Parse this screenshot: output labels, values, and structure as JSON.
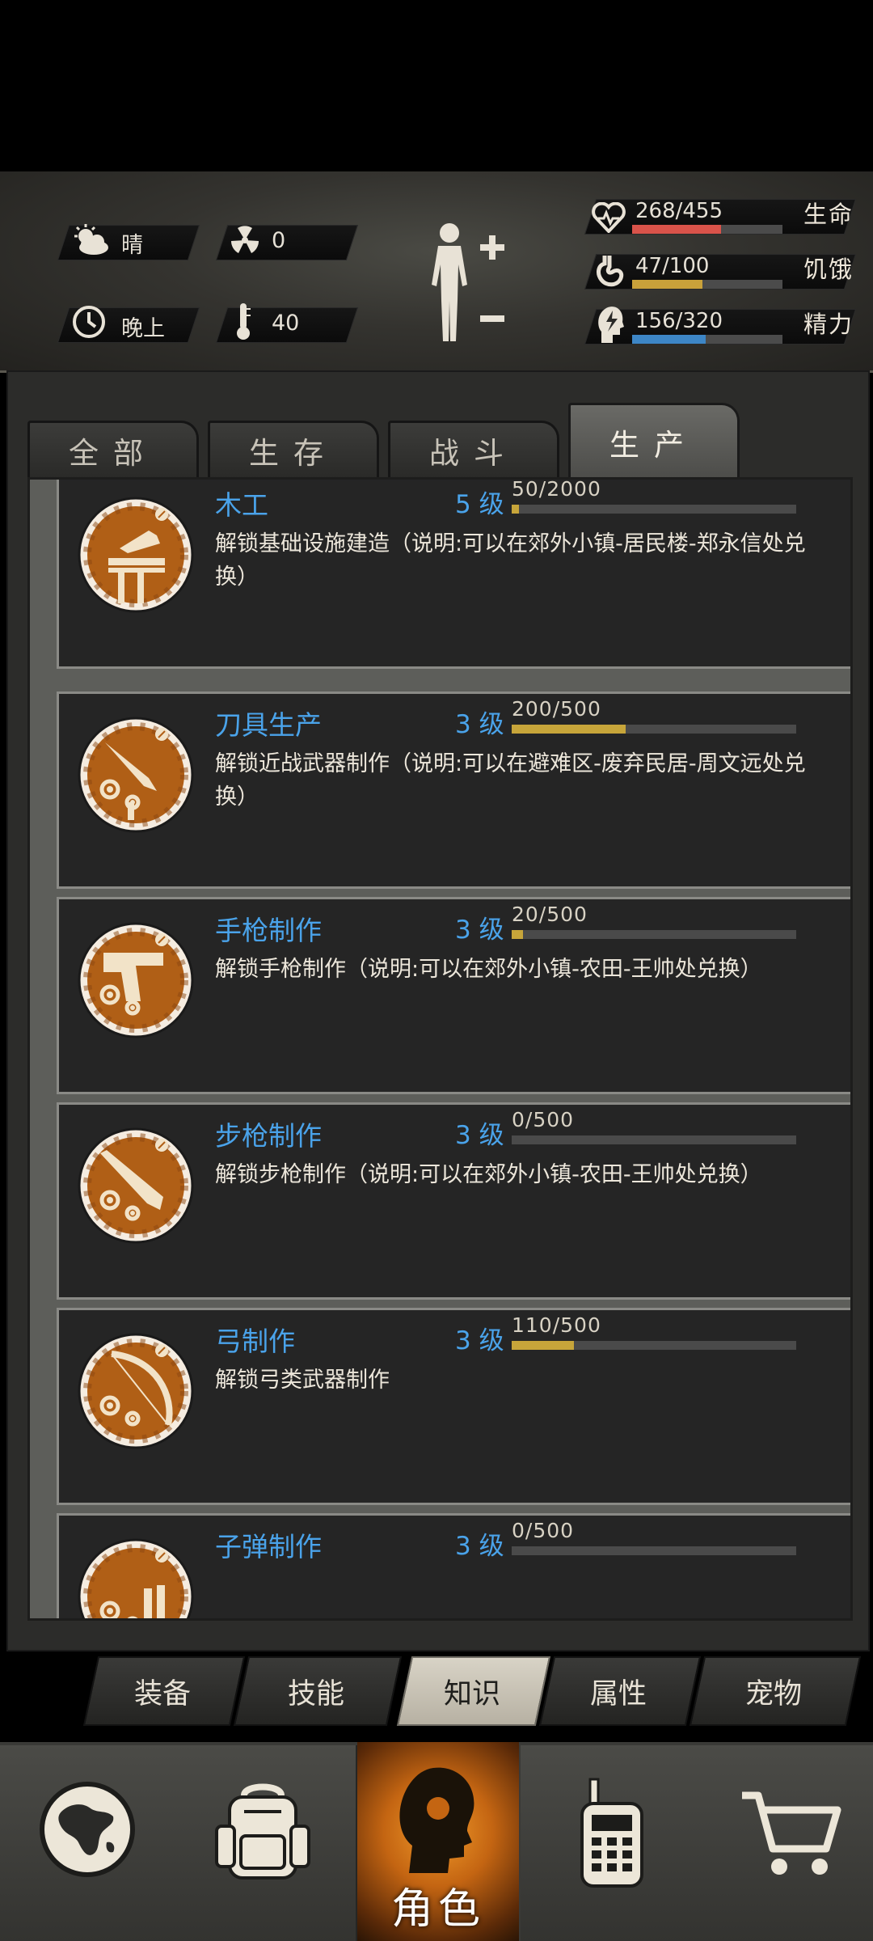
{
  "status": {
    "weather": "晴",
    "radiation": "0",
    "time_of_day": "晚上",
    "temperature": "40",
    "life": {
      "label": "生命",
      "text": "268/455",
      "fraction": 0.589,
      "color": "#d9534a"
    },
    "hunger": {
      "label": "饥饿",
      "text": "47/100",
      "fraction": 0.47,
      "color": "#c9a13a"
    },
    "energy": {
      "label": "精力",
      "text": "156/320",
      "fraction": 0.4875,
      "color": "#3d86c6"
    }
  },
  "tabs": [
    "全部",
    "生存",
    "战斗",
    "生产"
  ],
  "active_tab": 3,
  "skills": [
    {
      "name": "木工",
      "level": "5 级",
      "progress": "50/2000",
      "fraction": 0.025,
      "desc": "解锁基础设施建造（说明:可以在郊外小镇-居民楼-郑永信处兑换）",
      "icon": "woodwork-icon"
    },
    {
      "name": "刀具生产",
      "level": "3 级",
      "progress": "200/500",
      "fraction": 0.4,
      "desc": "解锁近战武器制作（说明:可以在避难区-废弃民居-周文远处兑换）",
      "icon": "knife-gear-icon"
    },
    {
      "name": "手枪制作",
      "level": "3 级",
      "progress": "20/500",
      "fraction": 0.04,
      "desc": "解锁手枪制作（说明:可以在郊外小镇-农田-王帅处兑换）",
      "icon": "pistol-gear-icon"
    },
    {
      "name": "步枪制作",
      "level": "3 级",
      "progress": "0/500",
      "fraction": 0.0,
      "desc": "解锁步枪制作（说明:可以在郊外小镇-农田-王帅处兑换）",
      "icon": "rifle-gear-icon"
    },
    {
      "name": "弓制作",
      "level": "3 级",
      "progress": "110/500",
      "fraction": 0.22,
      "desc": "解锁弓类武器制作",
      "icon": "bow-gear-icon"
    },
    {
      "name": "子弹制作",
      "level": "3 级",
      "progress": "0/500",
      "fraction": 0.0,
      "desc": "",
      "icon": "bullet-gear-icon"
    }
  ],
  "subtabs": [
    "装备",
    "技能",
    "知识",
    "属性",
    "宠物"
  ],
  "active_subtab": 2,
  "bottom_nav": {
    "role_label": "角色"
  }
}
